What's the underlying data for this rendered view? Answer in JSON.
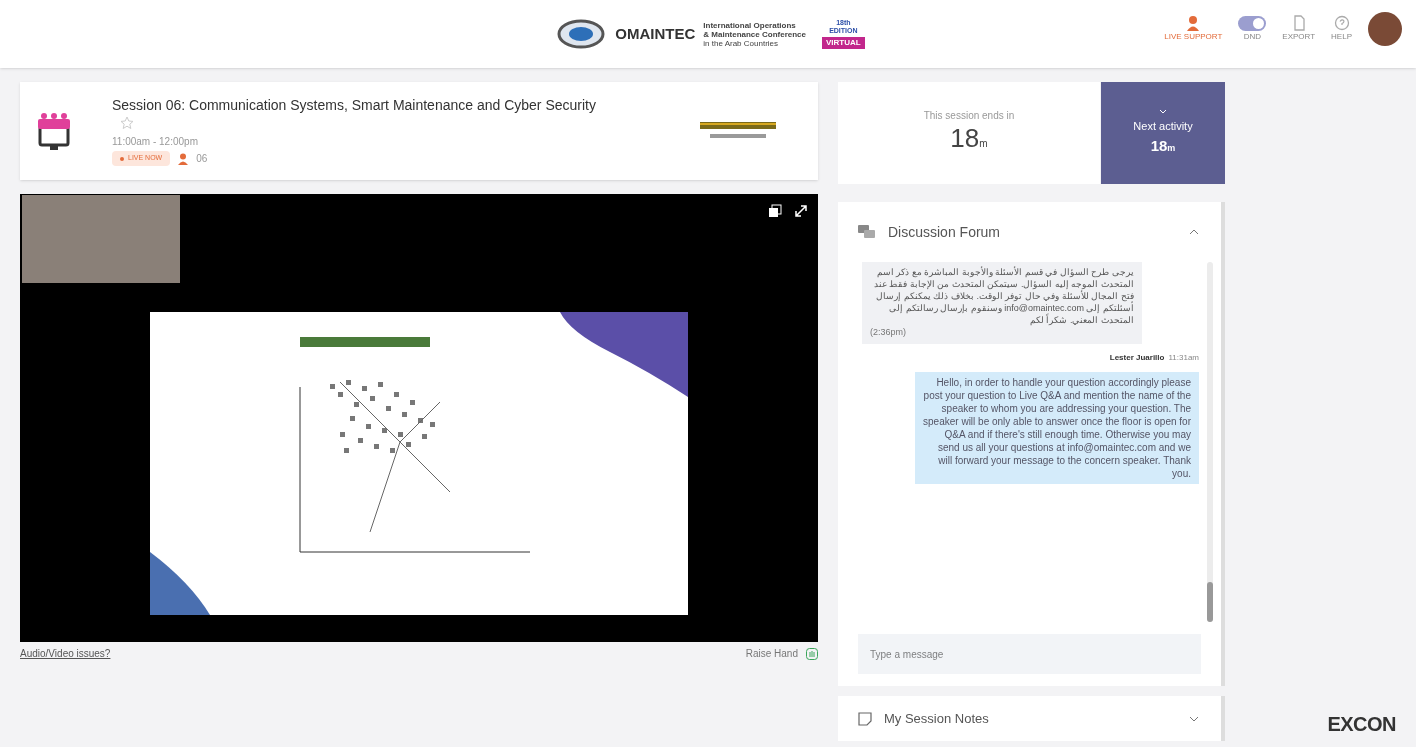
{
  "header": {
    "logo": {
      "name": "OMAINTEC",
      "lines": [
        "International Operations",
        "& Maintenance Conference",
        "in the Arab Countries"
      ],
      "edition": "18th EDITION",
      "badge": "VIRTUAL"
    },
    "actions": [
      {
        "kind": "support",
        "label": "LIVE SUPPORT"
      },
      {
        "kind": "toggle",
        "label": "DND",
        "on": true
      },
      {
        "kind": "export",
        "label": "EXPORT"
      },
      {
        "kind": "help",
        "label": "HELP"
      },
      {
        "kind": "avatar"
      }
    ]
  },
  "session": {
    "title": "Session 06: Communication Systems, Smart Maintenance and Cyber Security",
    "favorite": false,
    "time": "11:00am - 12:00pm",
    "status": "LIVE NOW",
    "attendees": "06"
  },
  "video": {
    "issues_link": "Audio/Video issues?",
    "raise_hand": "Raise Hand"
  },
  "timer": {
    "label": "This session ends in",
    "value": "18",
    "unit": "m"
  },
  "next_activity": {
    "label": "Next activity",
    "value": "18",
    "unit": "m"
  },
  "forum": {
    "title": "Discussion Forum",
    "expanded": true,
    "placeholder": "Type a message",
    "messages": [
      {
        "kind": "received",
        "text": "يرجى طرح السؤال في قسم الأسئلة والأجوبة المباشرة مع ذكر اسم المتحدث الموجه إليه السؤال. سيتمكن المتحدث من الإجابة فقط عند فتح المجال للأسئلة وفي حال توفر الوقت. بخلاف ذلك يمكنكم إرسال أسئلتكم إلى info@omaintec.com وسنقوم بإرسال رسالتكم إلى المتحدث المعني. شكراً لكم",
        "time": "(2:36pm)"
      },
      {
        "kind": "sent",
        "author": "Lester Juarillo",
        "time": "11:31am",
        "text": "Hello, in order to handle your question accordingly please post your question to Live Q&A and mention the name of the speaker to whom you are addressing your question. The speaker will be only able to answer once the floor is open for Q&A and if there's still enough time. Otherwise you may send us all your questions at info@omaintec.com and we will forward your message to the concern speaker. Thank you."
      }
    ]
  },
  "notes": {
    "title": "My Session Notes",
    "expanded": false
  },
  "footer_logo": "EXCON"
}
